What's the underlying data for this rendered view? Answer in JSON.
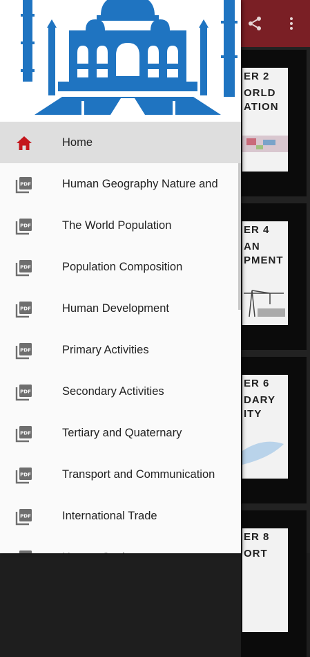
{
  "toolbar": {
    "share_icon": "share-icon",
    "overflow_icon": "more-vert-icon",
    "color": "#7a1f25"
  },
  "background_cards": [
    {
      "line1": "ER 2",
      "line2": "ORLD",
      "line3": "ATION"
    },
    {
      "line1": "ER 4",
      "line2": "AN",
      "line3": "PMENT"
    },
    {
      "line1": "ER 6",
      "line2": "DARY",
      "line3": "ITY"
    },
    {
      "line1": "ER 8",
      "line2": "ORT",
      "line3": ""
    }
  ],
  "drawer": {
    "header_image": "taj-mahal-logo",
    "accent_color": "#c4161c",
    "items": [
      {
        "label": "Home",
        "icon": "home-icon",
        "active": true
      },
      {
        "label": "Human Geography Nature and",
        "icon": "pdf-icon",
        "active": false
      },
      {
        "label": "The World Population",
        "icon": "pdf-icon",
        "active": false
      },
      {
        "label": "Population Composition",
        "icon": "pdf-icon",
        "active": false
      },
      {
        "label": "Human Development",
        "icon": "pdf-icon",
        "active": false
      },
      {
        "label": "Primary Activities",
        "icon": "pdf-icon",
        "active": false
      },
      {
        "label": "Secondary Activities",
        "icon": "pdf-icon",
        "active": false
      },
      {
        "label": "Tertiary and Quaternary",
        "icon": "pdf-icon",
        "active": false
      },
      {
        "label": "Transport and Communication",
        "icon": "pdf-icon",
        "active": false
      },
      {
        "label": "International Trade",
        "icon": "pdf-icon",
        "active": false
      },
      {
        "label": "Human Settlements",
        "icon": "pdf-icon",
        "active": false
      }
    ]
  }
}
